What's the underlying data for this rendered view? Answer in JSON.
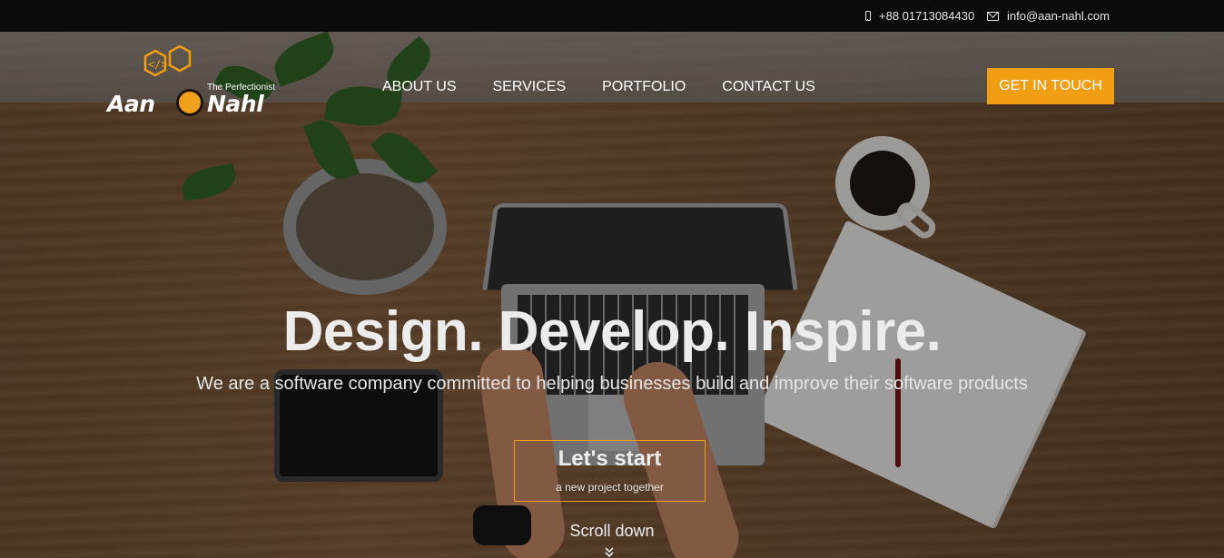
{
  "topbar": {
    "phone": "+88 01713084430",
    "email": "info@aan-nahl.com",
    "phone_icon": "mobile-phone-icon",
    "email_icon": "envelope-icon"
  },
  "header": {
    "logo": {
      "tagline": "The Perfectionist",
      "word_left": "Aan",
      "word_right": "Nahl",
      "code_glyph": "</>"
    },
    "nav": [
      {
        "label": "ABOUT US"
      },
      {
        "label": "SERVICES"
      },
      {
        "label": "PORTFOLIO"
      },
      {
        "label": "CONTACT US"
      }
    ],
    "cta_label": "GET IN TOUCH"
  },
  "hero": {
    "headline": "Design. Develop. Inspire.",
    "subheadline": "We are a software company committed to helping businesses build and improve their software products",
    "start_button": {
      "title": "Let's start",
      "subtitle": "a new project together"
    },
    "scroll_label": "Scroll down",
    "scroll_icon": "double-chevron-down-icon"
  },
  "colors": {
    "accent": "#f29e13",
    "topbar_bg": "#0b0b0b",
    "text": "#ffffff"
  }
}
